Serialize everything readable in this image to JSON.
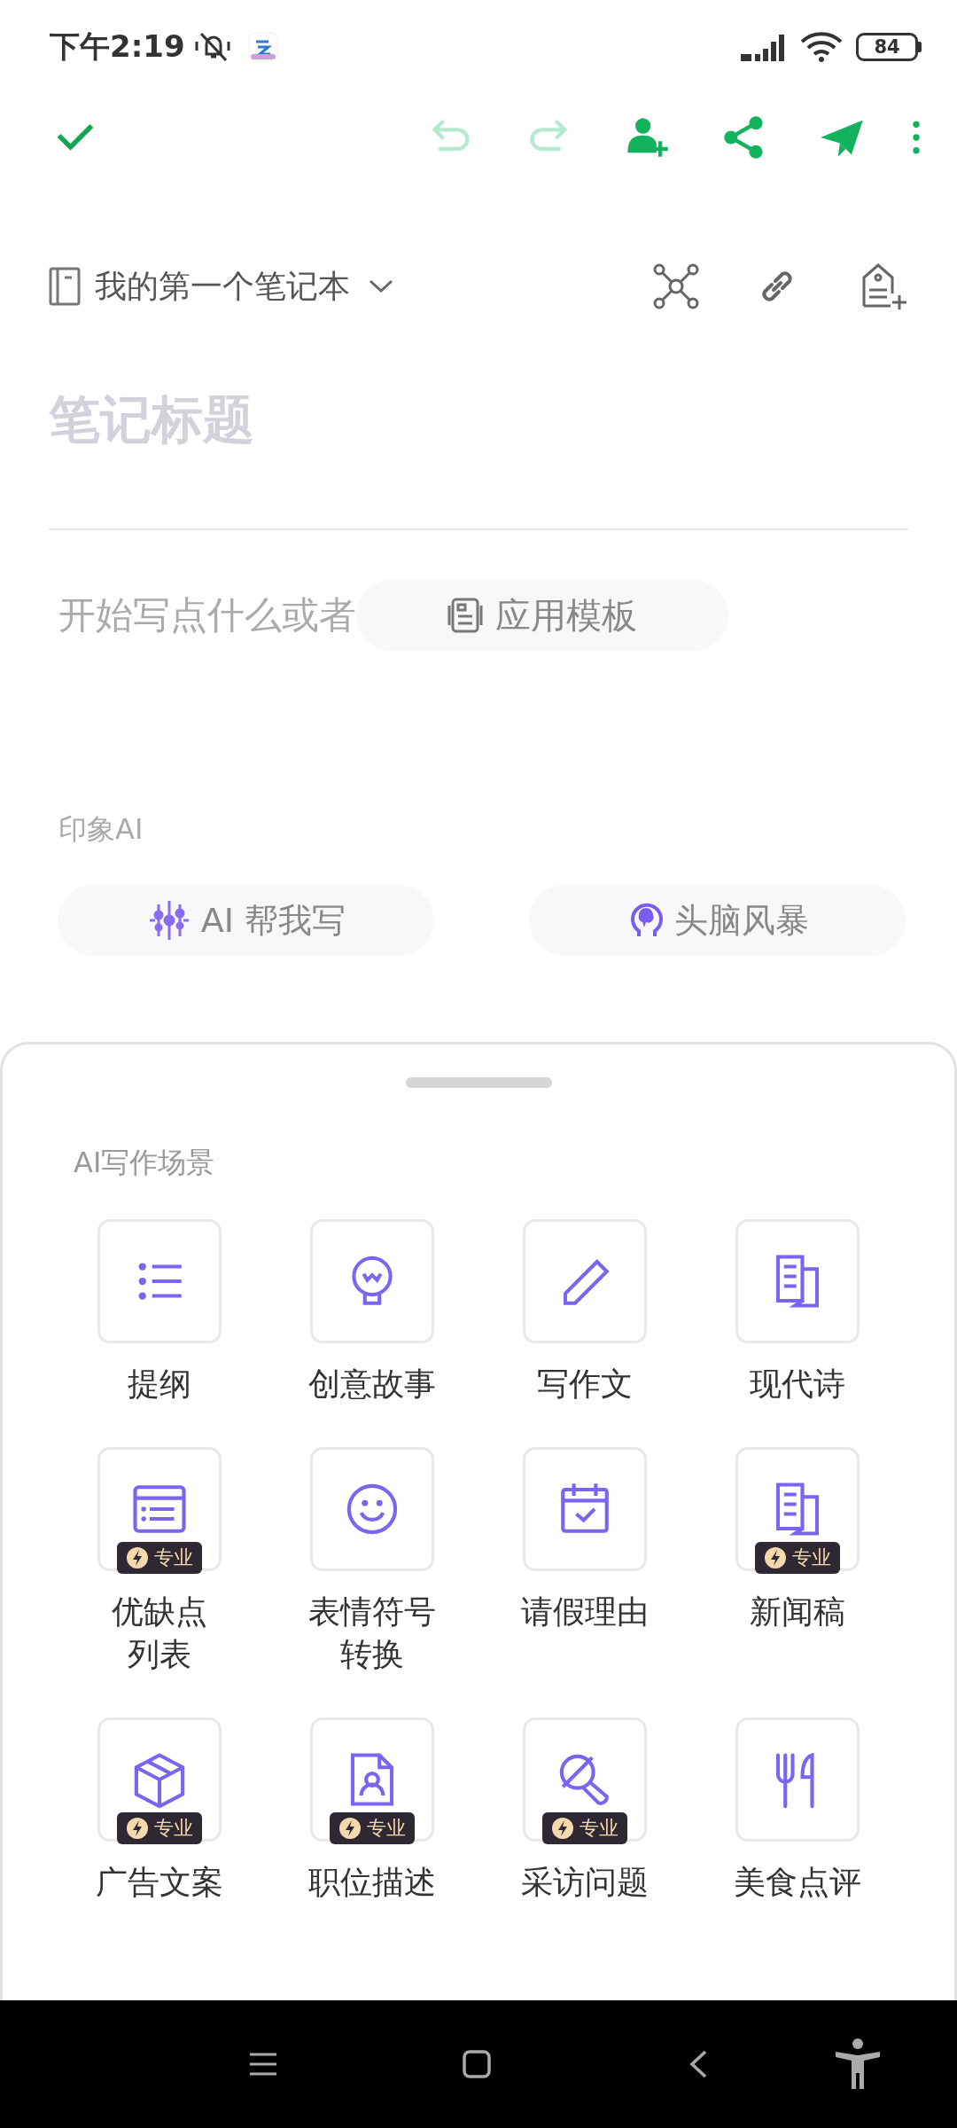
{
  "status_bar": {
    "time": "下午2:19",
    "battery": "84"
  },
  "toolbar": {
    "buttons": [
      {
        "kind": "done",
        "disabled": false
      },
      {
        "kind": "undo",
        "disabled": true
      },
      {
        "kind": "redo",
        "disabled": true
      },
      {
        "kind": "invite",
        "disabled": false
      },
      {
        "kind": "share",
        "disabled": false
      },
      {
        "kind": "send",
        "disabled": false
      },
      {
        "kind": "more",
        "disabled": false
      }
    ]
  },
  "notebook": {
    "name": "我的第一个笔记本"
  },
  "note": {
    "title_placeholder": "笔记标题",
    "body_placeholder": "开始写点什么或者",
    "template_button": "应用模板"
  },
  "ai_section": {
    "title": "印象AI",
    "buttons": [
      {
        "label": "AI 帮我写"
      },
      {
        "label": "头脑风暴"
      }
    ]
  },
  "sheet": {
    "title": "AI写作场景",
    "tiles": [
      {
        "lines": [
          "提纲"
        ]
      },
      {
        "lines": [
          "创意故事"
        ]
      },
      {
        "lines": [
          "写作文"
        ]
      },
      {
        "lines": [
          "现代诗"
        ]
      },
      {
        "lines": [
          "优缺点",
          "列表"
        ],
        "badge": "专业"
      },
      {
        "lines": [
          "表情符号",
          "转换"
        ]
      },
      {
        "lines": [
          "请假理由"
        ]
      },
      {
        "lines": [
          "新闻稿"
        ],
        "badge": "专业"
      },
      {
        "lines": [
          "广告文案"
        ],
        "badge": "专业"
      },
      {
        "lines": [
          "职位描述"
        ],
        "badge": "专业"
      },
      {
        "lines": [
          "采访问题"
        ],
        "badge": "专业"
      },
      {
        "lines": [
          "美食点评"
        ]
      }
    ]
  }
}
